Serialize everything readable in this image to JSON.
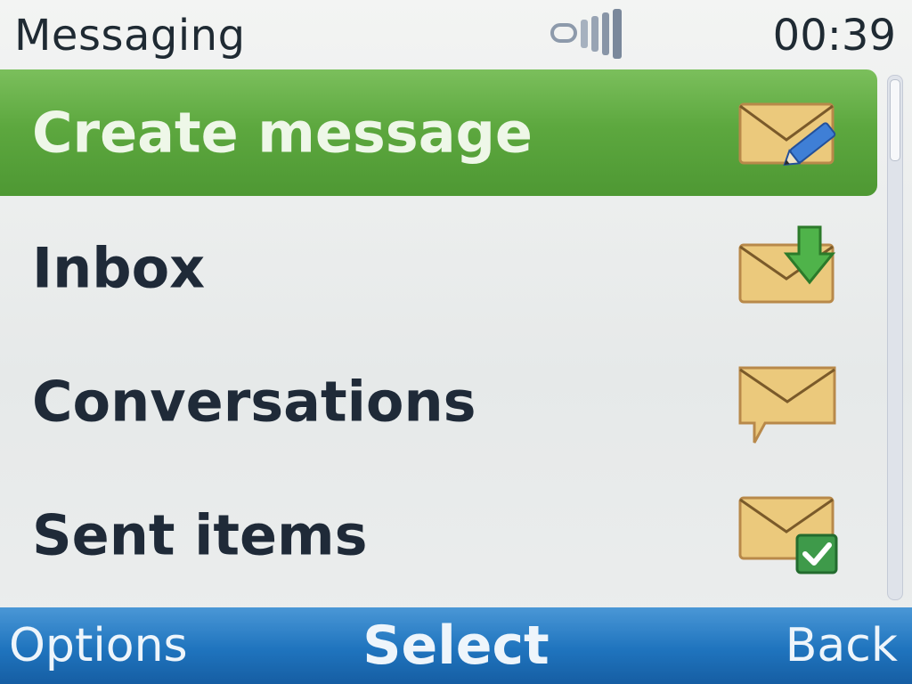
{
  "status_bar": {
    "title": "Messaging",
    "clock": "00:39",
    "signal_icon": "signal-icon"
  },
  "menu": {
    "items": [
      {
        "label": "Create message",
        "icon": "envelope-pencil-icon",
        "selected": true
      },
      {
        "label": "Inbox",
        "icon": "envelope-download-icon",
        "selected": false
      },
      {
        "label": "Conversations",
        "icon": "envelope-speech-icon",
        "selected": false
      },
      {
        "label": "Sent items",
        "icon": "envelope-check-icon",
        "selected": false
      }
    ]
  },
  "softkeys": {
    "left": "Options",
    "center": "Select",
    "right": "Back"
  },
  "colors": {
    "selection": "#5da83f",
    "softkey_bar": "#1f74be",
    "envelope": "#e9c277"
  }
}
